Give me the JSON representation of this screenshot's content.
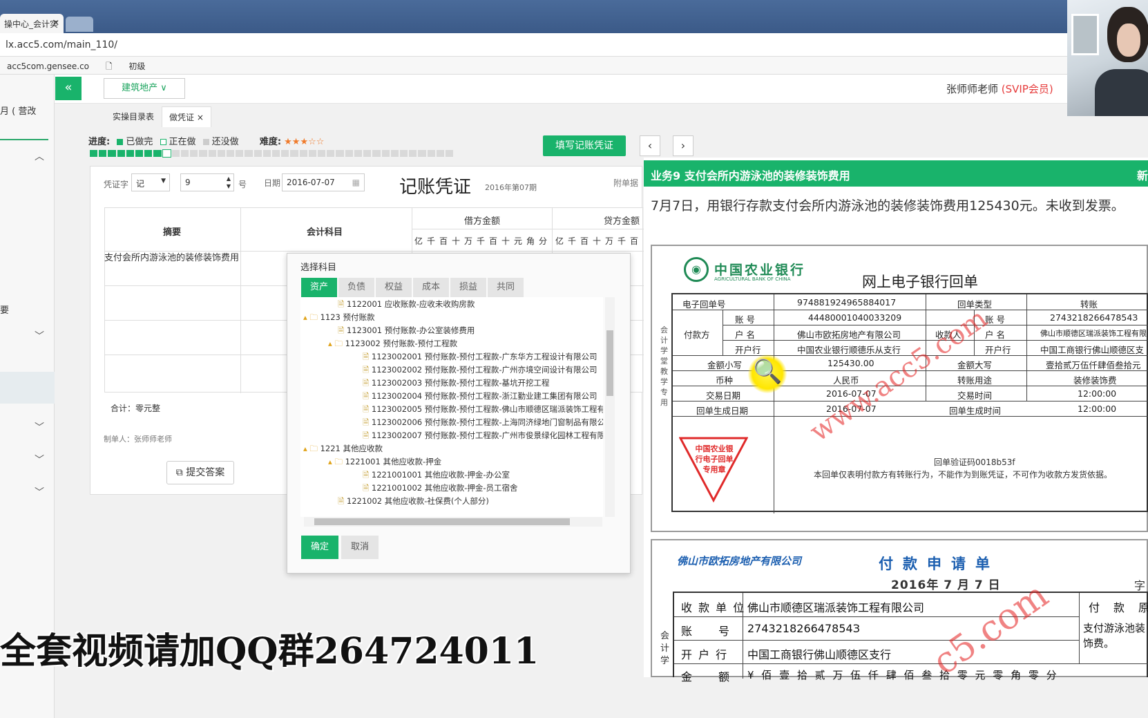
{
  "browser": {
    "tab_title": "操中心_会计实",
    "url": "lx.acc5.com/main_110/",
    "bookmarks": [
      "acc5com.gensee.co",
      "初级"
    ]
  },
  "sidebar": {
    "partial_text": "月 ( 营改",
    "partial_text2": "要"
  },
  "header": {
    "project": "建筑地产 ∨",
    "user": "张师师老师",
    "user_badge": "(SVIP会员)",
    "collapse_icon": "«"
  },
  "subtabs": {
    "tab1": "实操目录表",
    "tab2": "做凭证",
    "tab2_close": "×"
  },
  "progress": {
    "label": "进度:",
    "done": "已做完",
    "doing": "正在做",
    "todo": "还没做",
    "difficulty_label": "难度:",
    "stars": "★★★☆☆",
    "done_count": 8,
    "current_index": 9,
    "total": 40
  },
  "actions": {
    "fill_button": "填写记账凭证",
    "prev": "‹",
    "next": "›"
  },
  "voucher": {
    "type_label": "凭证字",
    "type_value": "记",
    "number": "9",
    "number_suffix": "号",
    "date_label": "日期",
    "date_value": "2016-07-07",
    "title": "记账凭证",
    "period": "2016年第07期",
    "attachments_label": "附单据",
    "col_summary": "摘要",
    "col_account": "会计科目",
    "col_debit": "借方金额",
    "col_credit": "贷方金额",
    "digits_debit": "亿千百十万千百十元角分",
    "digits_credit": "亿千百十万千百",
    "summary_text": "支付会所内游泳池的装修装饰费用",
    "total": "合计：零元整",
    "maker": "制单人：张师师老师",
    "submit": "提交答案"
  },
  "dialog": {
    "title": "选择科目",
    "tabs": [
      "资产",
      "负债",
      "权益",
      "成本",
      "损益",
      "共同"
    ],
    "items": [
      "1122001 应收账款-应收未收购房款",
      "1123 预付账款",
      "1123001 预付账款-办公室装修费用",
      "1123002 预付账款-预付工程款",
      "1123002001 预付账款-预付工程款-广东华方工程设计有限公司",
      "1123002002 预付账款-预付工程款-广州亦境空间设计有限公司",
      "1123002003 预付账款-预付工程款-基坑开挖工程",
      "1123002004 预付账款-预付工程款-浙江勤业建工集团有限公司",
      "1123002005 预付账款-预付工程款-佛山市顺德区瑞派装饰工程有",
      "1123002006 预付账款-预付工程款-上海同济绿地门窗制品有限公",
      "1123002007 预付账款-预付工程款-广州市俊景绿化园林工程有限",
      "1221 其他应收款",
      "1221001 其他应收款-押金",
      "1221001001 其他应收款-押金-办公室",
      "1221001002 其他应收款-押金-员工宿舍",
      "1221002 其他应收款-社保费(个人部分)"
    ],
    "ok": "确定",
    "cancel": "取消"
  },
  "task": {
    "header": "业务9 支付会所内游泳池的装修装饰费用",
    "header_right": "新",
    "description": "7月7日，用银行存款支付会所内游泳池的装修装饰费用125430元。未收到发票。"
  },
  "receipt": {
    "bank_cn": "中国农业银行",
    "bank_en": "AGRICULTURAL BANK OF CHINA",
    "title": "网上电子银行回单",
    "side_label": "会计学堂教学专用",
    "no_label": "电子回单号",
    "no": "974881924965884017",
    "type_label": "回单类型",
    "type": "转账",
    "payer_label": "付款方",
    "payee_label": "收款人",
    "acct_label": "账 号",
    "name_label": "户 名",
    "bank_label": "开户行",
    "payer_acct": "44480001040033209",
    "payer_name": "佛山市欧拓房地产有限公司",
    "payer_bank": "中国农业银行顺德乐从支行",
    "payee_acct": "274321826647854З",
    "payee_name": "佛山市顺德区瑞派装饰工程有限",
    "payee_bank": "中国工商银行佛山顺德区支",
    "amt_small_label": "金额小写",
    "amt_small": "125430.00",
    "amt_big_label": "金额大写",
    "amt_big": "壹拾贰万伍仟肆佰叁拾元",
    "currency_label": "币种",
    "currency": "人民币",
    "purpose_label": "转账用途",
    "purpose": "装修装饰费",
    "date_label": "交易日期",
    "date": "2016-07-07",
    "time_label": "交易时间",
    "time": "12:00:00",
    "gen_date_label": "回单生成日期",
    "gen_date": "2016-07-07",
    "gen_time_label": "回单生成时间",
    "gen_time": "12:00:00",
    "stamp_text": "中国农业银行电子回单专用章",
    "verify": "回单验证码0018b53f",
    "note": "本回单仅表明付款方有转账行为，不能作为到账凭证，不可作为收款方发货依据。",
    "watermark": "www.acc5.com"
  },
  "payment": {
    "company": "佛山市欧拓房地产有限公司",
    "title": "付款申请单",
    "date": "2016年 7 月 7 日",
    "zi": "字",
    "side_label": "会计学",
    "payee_label": "收 款 单 位",
    "payee": "佛山市顺德区瑞派装饰工程有限公司",
    "acct_label": "账　　号",
    "acct": "274321826647854З",
    "bank_label": "开 户 行",
    "bank": "中国工商银行佛山顺德区支行",
    "amount_label": "金　　额",
    "amount_row": "¥ 佰 壹 拾 贰 万 伍 仟 肆 佰 叁 拾 零 元 零 角 零 分",
    "reason_label": "付　款　原",
    "reason": "支付游泳池装饰费。",
    "watermark": "c5.com"
  },
  "overlay": {
    "promo": "全套视频请加QQ群264724011"
  }
}
